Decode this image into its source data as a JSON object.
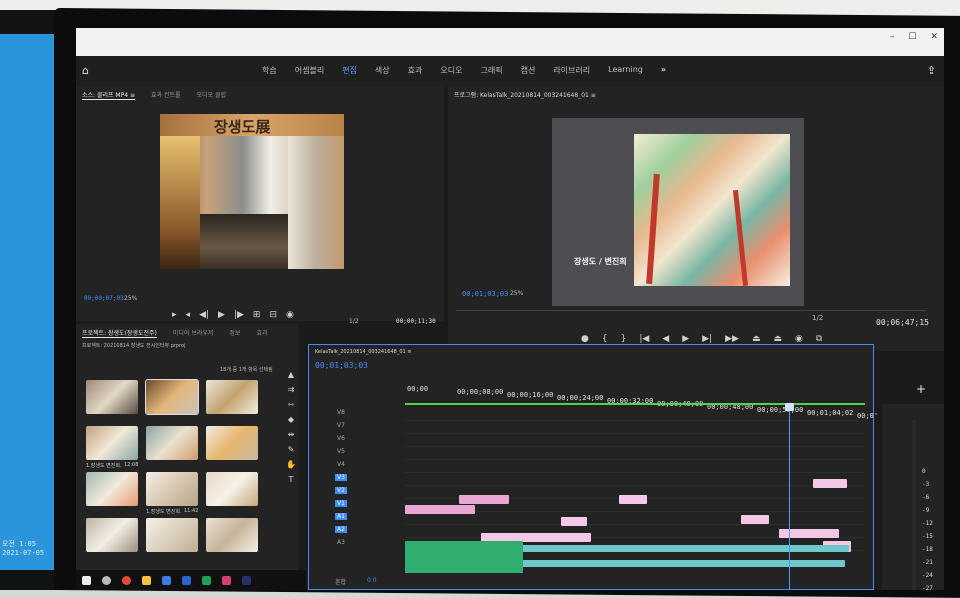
{
  "workspace_menu": {
    "items": [
      "학습",
      "어셈블리",
      "편집",
      "색상",
      "효과",
      "오디오",
      "그래픽",
      "캡션",
      "라이브러리",
      "Learning"
    ],
    "active_index": 2,
    "more_glyph": "»"
  },
  "source_panel": {
    "tabs": [
      "소스: 클리프 MP4 ≡",
      "효과 컨트롤",
      "오디오 클립"
    ],
    "timecode_left": "00;00;07;03",
    "zoom": "25%",
    "resolution": "1/2",
    "timecode_right": "00;00;11;30",
    "clip_text": "장생도展"
  },
  "program_panel": {
    "title": "프로그램: KelasTalk_20210814_003241648_01 ≡",
    "timecode_left": "00;01;03;03",
    "zoom": "25%",
    "resolution": "1/2",
    "timecode_right": "00;06;47;15",
    "caption": "장생도 / 변진희"
  },
  "project_panel": {
    "tabs": [
      "프로젝트: 장생도(장생도전주)",
      "미디어 브라우저",
      "정보",
      "효과"
    ],
    "path": "프로젝트: 20210814 장생도 전시인터뷰 prproj",
    "selected_count": "18개 중 1개 항목 선택됨",
    "thumb_labels": [
      "",
      "",
      "",
      "1.장생도 변진희.",
      "",
      "",
      "",
      "1.장생도 변진희.",
      "",
      "",
      "",
      ""
    ],
    "thumb_durations": [
      "",
      "",
      "",
      "12:08",
      "",
      "",
      "",
      "11:42",
      "",
      "",
      "",
      ""
    ]
  },
  "timeline": {
    "sequence_name": "KelasTalk_20210814_003241648_01 ≡",
    "timecode": "00;01;03;03",
    "ruler": [
      "00;00",
      "00;00;08;00",
      "00;00;16;00",
      "00;00;24;00",
      "00;00;32;00",
      "00;00;40;00",
      "00;00;48;00",
      "00;00;56;00",
      "00;01;04;02",
      "00;0'"
    ],
    "video_tracks": [
      "V8",
      "V7",
      "V6",
      "V5",
      "V4",
      "V3",
      "V2",
      "V1"
    ],
    "audio_tracks": [
      "A1",
      "A2",
      "A3"
    ],
    "mix_label": "혼합",
    "mix_value": "0.0"
  },
  "audio_meter": {
    "labels": [
      "0",
      "-3",
      "-6",
      "-9",
      "-12",
      "-15",
      "-18",
      "-21",
      "-24",
      "-27",
      "-30",
      "-33"
    ]
  },
  "left_monitor": {
    "clock_time": "오전 1:05",
    "clock_date": "2021-07-05"
  },
  "colors": {
    "accent_blue": "#3f8cff",
    "clip_pink": "#e9a7d4",
    "clip_lightpink": "#f3c7e6",
    "clip_teal": "#6ec7c9",
    "audio_green": "#2fae6f",
    "playhead_line": "#4aa0ff",
    "work_area_green": "#4fd34f",
    "panel_bg": "#232323"
  }
}
